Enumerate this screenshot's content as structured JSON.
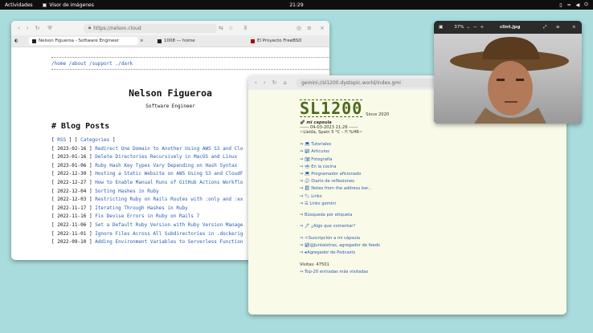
{
  "topbar": {
    "activities": "Actividades",
    "app": "Visor de imágenes",
    "clock": "21:29"
  },
  "browser1": {
    "url": "https://nelson.cloud",
    "tabs": [
      "Nelson Figueroa - Software Engineer",
      "1008 — home",
      "El Proyecto FreeBSD"
    ],
    "nav": "/home /about /support ./dark",
    "name": "Nelson Figueroa",
    "subtitle": "Software Engineer",
    "blog_header": "# Blog Posts",
    "rss": "RSS",
    "categories": "Categories",
    "posts": [
      {
        "date": "[ 2023-02-16 ]",
        "title": "Redirect One Domain to Another Using AWS S3 and Clo"
      },
      {
        "date": "[ 2023-01-16 ]",
        "title": "Delete Directories Recursively in MacOS and Linux"
      },
      {
        "date": "[ 2023-01-06 ]",
        "title": "Ruby Hash Key Types Vary Depending on Hash Syntax"
      },
      {
        "date": "[ 2022-12-30 ]",
        "title": "Hosting a Static Website on AWS Using S3 and CloudF"
      },
      {
        "date": "[ 2022-12-27 ]",
        "title": "How to Enable Manual Runs of GitHub Actions Workflo"
      },
      {
        "date": "[ 2022-12-04 ]",
        "title": "Sorting Hashes in Ruby"
      },
      {
        "date": "[ 2022-12-03 ]",
        "title": "Restricting Ruby on Rails Routes with :only and :ex"
      },
      {
        "date": "[ 2022-11-17 ]",
        "title": "Iterating Through Hashes in Ruby"
      },
      {
        "date": "[ 2022-11-16 ]",
        "title": "Fix Devise Errors in Ruby on Rails 7"
      },
      {
        "date": "[ 2022-11-06 ]",
        "title": "Set a Default Ruby Version with Ruby Version Manage"
      },
      {
        "date": "[ 2022-11-01 ]",
        "title": "Ignore Files Across All Subdirectories in .dockerig"
      },
      {
        "date": "[ 2022-09-10 ]",
        "title": "Adding Environment Variables to Serverless Function"
      }
    ]
  },
  "browser2": {
    "url": "gemini://sl1200.dystopic.world/index.gmi",
    "logo": "SL1200",
    "since": "Since 2020",
    "capsule": "mi capsula",
    "datetime": "------ 04-03-2023  21:26 ------",
    "weather": "~Lleida, Spain 5 °C - ?l %HR~",
    "items": [
      "Tutoriales",
      "Artículos",
      "Fotografía",
      "En la cocina",
      "Programador aficionado",
      "Diario de reflexiones",
      "Notes from the address bar...",
      "Links",
      "Links gemini"
    ],
    "search": "Búsqueda por etiqueta",
    "comment": "¿Algo que comentar?",
    "subs": [
      "Suscripción a mi cápsula",
      "@Juntaletras, agregador de feeds",
      "Agregador de Podcasts"
    ],
    "visits": "Visitas: 47501",
    "top20": "Top-20 entradas más visitadas"
  },
  "viewer": {
    "zoom": "37%",
    "filename": "clint.jpg"
  }
}
